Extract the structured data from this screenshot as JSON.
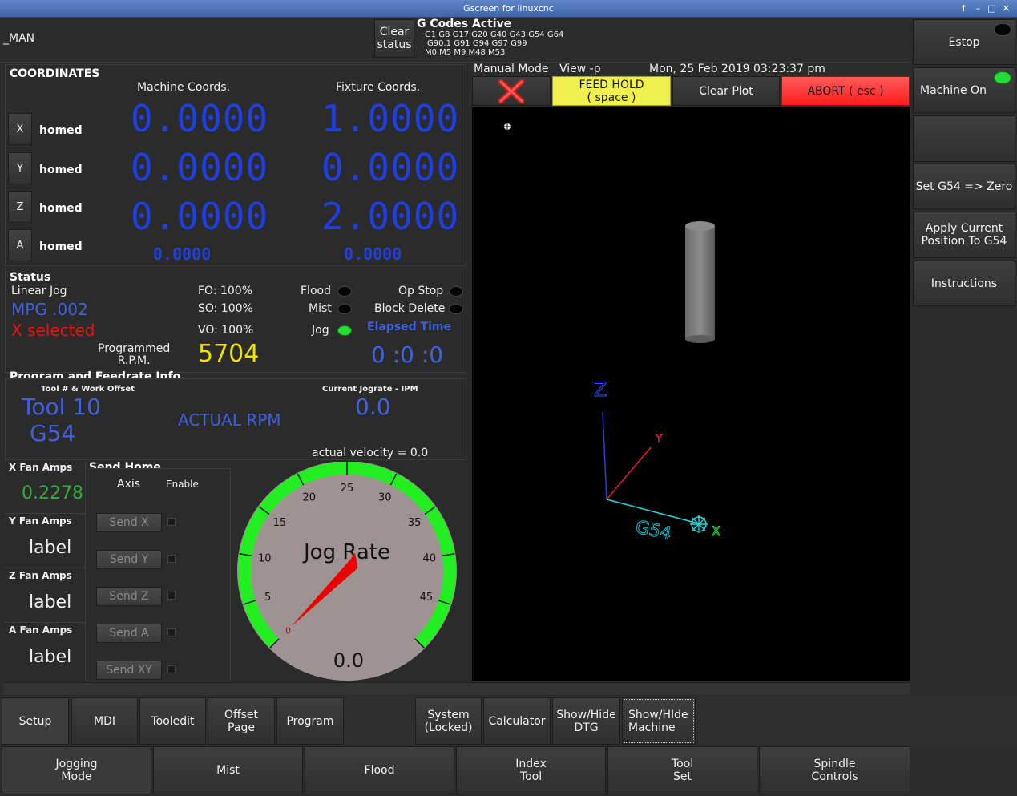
{
  "window": {
    "title": "Gscreen for linuxcnc"
  },
  "top": {
    "mode_label": "_MAN",
    "clear_status": "Clear\nstatus",
    "gcodes_title": "G Codes Active",
    "gcodes_line1": "G1 G8 G17 G20 G40 G43 G54 G64",
    "gcodes_line2": "G90.1 G91 G94 G97 G99",
    "gcodes_line3": "M0 M5 M9 M48 M53"
  },
  "coords": {
    "title": "COORDINATES",
    "machine_header": "Machine Coords.",
    "fixture_header": "Fixture Coords.",
    "axes": [
      {
        "axis": "X",
        "state": "homed",
        "machine": "0.0000",
        "fixture": "1.0000"
      },
      {
        "axis": "Y",
        "state": "homed",
        "machine": "0.0000",
        "fixture": "0.0000"
      },
      {
        "axis": "Z",
        "state": "homed",
        "machine": "0.0000",
        "fixture": "2.0000"
      },
      {
        "axis": "A",
        "state": "homed",
        "machine": "0.0000",
        "fixture": "0.0000"
      }
    ]
  },
  "status": {
    "title": "Status",
    "linear_jog": "Linear Jog",
    "mpg": "MPG .002",
    "selected": "X selected",
    "fo": "FO: 100%",
    "so": "SO: 100%",
    "vo": "VO: 100%",
    "flood": "Flood",
    "mist": "Mist",
    "jog": "Jog",
    "op_stop": "Op Stop",
    "block_delete": "Block Delete",
    "elapsed_title": "Elapsed Time",
    "elapsed": "0 :0 :0",
    "prog_rpm_label": "Programmed\nR.P.M.",
    "prog_rpm": "5704"
  },
  "program": {
    "title": "Program and Feedrate Info.",
    "tool_header": "Tool # & Work Offset",
    "tool": "Tool 10",
    "offset": "G54",
    "actual_rpm": "ACTUAL RPM",
    "jograte_header": "Current Jograte - IPM",
    "jograte": "0.0",
    "actual_velocity": "actual velocity = 0.0"
  },
  "fans": [
    {
      "label": "X Fan Amps",
      "value": "0.2278"
    },
    {
      "label": "Y Fan Amps",
      "value": "label"
    },
    {
      "label": "Z Fan Amps",
      "value": "label"
    },
    {
      "label": "A Fan Amps",
      "value": "label"
    }
  ],
  "send_home": {
    "title": "Send Home",
    "axis_header": "Axis",
    "enable_header": "Enable",
    "buttons": [
      "Send X",
      "Send Y",
      "Send Z",
      "Send A",
      "Send XY"
    ]
  },
  "gauge": {
    "label": "Jog Rate",
    "value_text": "0.0",
    "value": 0,
    "min": 0,
    "max": 50,
    "ticks": [
      "0",
      "5",
      "10",
      "15",
      "20",
      "25",
      "30",
      "35",
      "40",
      "45"
    ]
  },
  "view": {
    "mode": "Manual Mode",
    "view": "View -p",
    "datetime": "Mon, 25 Feb 2019  03:23:37 pm",
    "feed_hold": "FEED HOLD\n( space )",
    "clear_plot": "Clear Plot",
    "abort": "ABORT ( esc )",
    "axis_z": "Z",
    "axis_y": "Y",
    "axis_x": "X",
    "offset_label": "G54"
  },
  "right": {
    "estop": "Estop",
    "machine_on": "Machine On",
    "blank": "",
    "set_g54": "Set G54 => Zero",
    "apply_pos": "Apply Current\nPosition To G54",
    "instructions": "Instructions"
  },
  "tabs": [
    "Setup",
    "MDI",
    "Tooledit",
    "Offset\nPage",
    "Program"
  ],
  "tabs2": [
    "System\n(Locked)",
    "Calculator",
    "Show/Hide\nDTG",
    "Show/HIde\nMachine"
  ],
  "bottom": [
    "Jogging\nMode",
    "Mist",
    "Flood",
    "Index\nTool",
    "Tool\nSet",
    "Spindle\nControls"
  ],
  "colors": {
    "estop_led": "#050505",
    "machine_on_led": "#22dd33",
    "feed_hold": "#f0f050",
    "abort": "#ff2020"
  }
}
